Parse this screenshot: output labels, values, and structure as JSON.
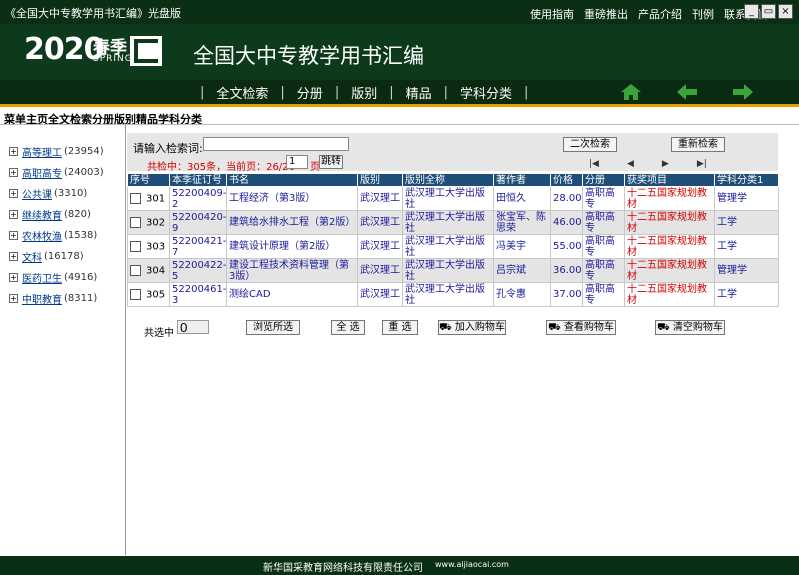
{
  "window": {
    "title": "《全国大中专教学用书汇编》光盘版",
    "top_menu": [
      "使用指南",
      "重磅推出",
      "产品介绍",
      "刊例",
      "联系我们"
    ],
    "controls": [
      "_",
      "▭",
      "×"
    ]
  },
  "banner": {
    "year": "2020",
    "season_cn": "春季",
    "season_en": "SPRING",
    "site_title": "全国大中专教学用书汇编"
  },
  "nav": {
    "items": [
      "全文检索",
      "分册",
      "版别",
      "精品",
      "学科分类"
    ],
    "icons": [
      "home-icon",
      "back-arrow-icon",
      "forward-arrow-icon"
    ]
  },
  "breadcrumb": "菜单主页全文检索分册版别精品学科分类",
  "sidebar": {
    "items": [
      {
        "label": "高等理工",
        "count": "(23954)"
      },
      {
        "label": "高职高专",
        "count": "(24003)"
      },
      {
        "label": "公共课",
        "count": "(3310)"
      },
      {
        "label": "继续教育",
        "count": "(820)"
      },
      {
        "label": "农林牧渔",
        "count": "(1538)"
      },
      {
        "label": "文科",
        "count": "(16178)"
      },
      {
        "label": "医药卫生",
        "count": "(4916)"
      },
      {
        "label": "中职教育",
        "count": "(8311)"
      }
    ]
  },
  "search": {
    "label": "请输入检索词:",
    "value": "",
    "second_search": "二次检索",
    "re_search": "重新检索",
    "stats": "共检中：305条，当前页：26/26",
    "page_value": "1",
    "page_unit": "页",
    "jump": "跳转"
  },
  "pager": [
    "|◀",
    "◀",
    "▶",
    "▶|"
  ],
  "table": {
    "headers": [
      "序号",
      "本季征订号",
      "书名",
      "版别",
      "版别全称",
      "著作者",
      "价格",
      "分册",
      "获奖项目",
      "学科分类1"
    ],
    "rows": [
      {
        "no": "301",
        "code": "52200409-2",
        "title": "工程经济（第3版）",
        "pub": "武汉理工",
        "pub_full": "武汉理工大学出版社",
        "author": "田恒久",
        "price": "28.00",
        "volume": "高职高专",
        "award": "十二五国家规划教材",
        "subject": "管理学"
      },
      {
        "no": "302",
        "code": "52200420-9",
        "title": "建筑给水排水工程（第2版）",
        "pub": "武汉理工",
        "pub_full": "武汉理工大学出版社",
        "author": "张宝军、陈思荣",
        "price": "46.00",
        "volume": "高职高专",
        "award": "十二五国家规划教材",
        "subject": "工学"
      },
      {
        "no": "303",
        "code": "52200421-7",
        "title": "建筑设计原理（第2版）",
        "pub": "武汉理工",
        "pub_full": "武汉理工大学出版社",
        "author": "冯美宇",
        "price": "55.00",
        "volume": "高职高专",
        "award": "十二五国家规划教材",
        "subject": "工学"
      },
      {
        "no": "304",
        "code": "52200422-5",
        "title": "建设工程技术资料管理（第3版）",
        "pub": "武汉理工",
        "pub_full": "武汉理工大学出版社",
        "author": "吕宗斌",
        "price": "36.00",
        "volume": "高职高专",
        "award": "十二五国家规划教材",
        "subject": "管理学"
      },
      {
        "no": "305",
        "code": "52200461-3",
        "title": "测绘CAD",
        "pub": "武汉理工",
        "pub_full": "武汉理工大学出版社",
        "author": "孔令惠",
        "price": "37.00",
        "volume": "高职高专",
        "award": "十二五国家规划教材",
        "subject": "工学"
      }
    ]
  },
  "actions": {
    "selected_label": "共选中",
    "selected_value": "0",
    "browse": "浏览所选",
    "select_all": "全 选",
    "reselect": "重 选",
    "add_cart": "加入购物车",
    "view_cart": "查看购物车",
    "clear_cart": "清空购物车"
  },
  "footer": {
    "company": "新华国采教育网络科技有限责任公司",
    "url": "www.aijiaocai.com"
  }
}
